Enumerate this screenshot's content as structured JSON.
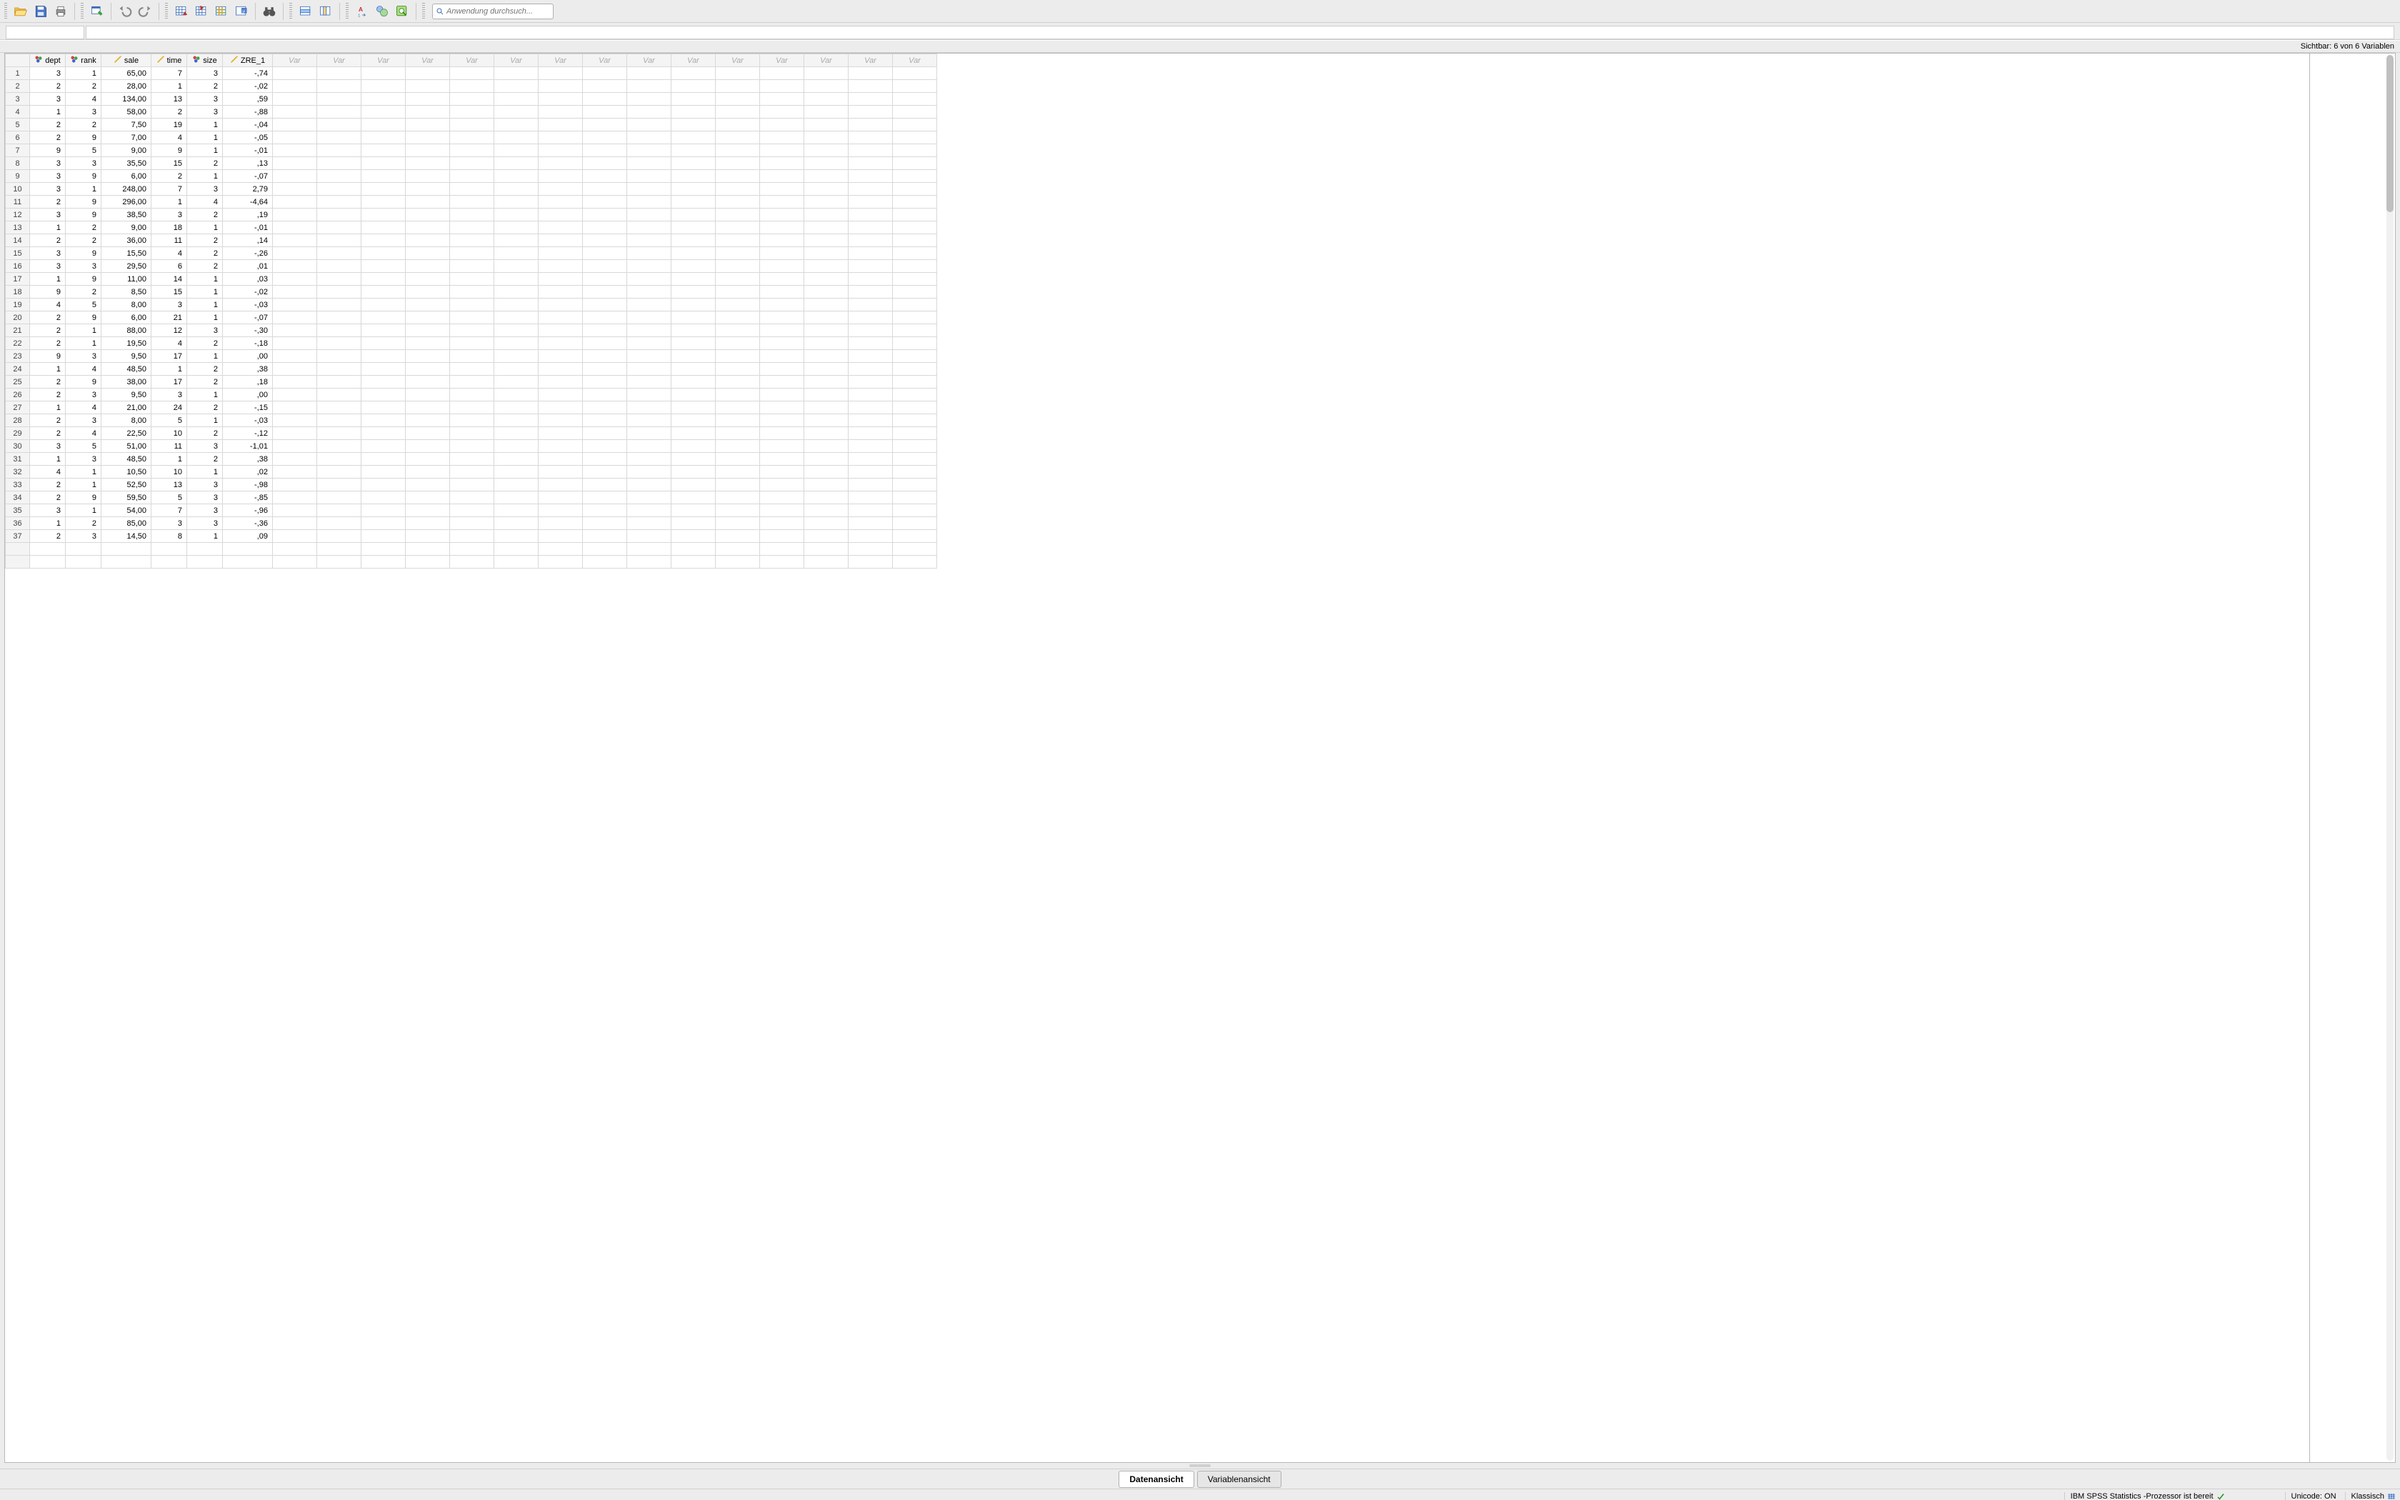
{
  "toolbar": {
    "search_placeholder": "Anwendung durchsuch..."
  },
  "visible_bar": "Sichtbar: 6 von 6 Variablen",
  "columns": [
    {
      "name": "dept",
      "type": "nominal",
      "width": "w-dept"
    },
    {
      "name": "rank",
      "type": "nominal",
      "width": "w-rank"
    },
    {
      "name": "sale",
      "type": "scale",
      "width": "w-sale"
    },
    {
      "name": "time",
      "type": "scale",
      "width": "w-time"
    },
    {
      "name": "size",
      "type": "nominal",
      "width": "w-size"
    },
    {
      "name": "ZRE_1",
      "type": "scale",
      "width": "w-zre"
    }
  ],
  "empty_var_label": "Var",
  "empty_var_count": 15,
  "rows": [
    {
      "dept": "3",
      "rank": "1",
      "sale": "65,00",
      "time": "7",
      "size": "3",
      "zre": "-,74"
    },
    {
      "dept": "2",
      "rank": "2",
      "sale": "28,00",
      "time": "1",
      "size": "2",
      "zre": "-,02"
    },
    {
      "dept": "3",
      "rank": "4",
      "sale": "134,00",
      "time": "13",
      "size": "3",
      "zre": ",59"
    },
    {
      "dept": "1",
      "rank": "3",
      "sale": "58,00",
      "time": "2",
      "size": "3",
      "zre": "-,88"
    },
    {
      "dept": "2",
      "rank": "2",
      "sale": "7,50",
      "time": "19",
      "size": "1",
      "zre": "-,04"
    },
    {
      "dept": "2",
      "rank": "9",
      "sale": "7,00",
      "time": "4",
      "size": "1",
      "zre": "-,05"
    },
    {
      "dept": "9",
      "rank": "5",
      "sale": "9,00",
      "time": "9",
      "size": "1",
      "zre": "-,01"
    },
    {
      "dept": "3",
      "rank": "3",
      "sale": "35,50",
      "time": "15",
      "size": "2",
      "zre": ",13"
    },
    {
      "dept": "3",
      "rank": "9",
      "sale": "6,00",
      "time": "2",
      "size": "1",
      "zre": "-,07"
    },
    {
      "dept": "3",
      "rank": "1",
      "sale": "248,00",
      "time": "7",
      "size": "3",
      "zre": "2,79"
    },
    {
      "dept": "2",
      "rank": "9",
      "sale": "296,00",
      "time": "1",
      "size": "4",
      "zre": "-4,64"
    },
    {
      "dept": "3",
      "rank": "9",
      "sale": "38,50",
      "time": "3",
      "size": "2",
      "zre": ",19"
    },
    {
      "dept": "1",
      "rank": "2",
      "sale": "9,00",
      "time": "18",
      "size": "1",
      "zre": "-,01"
    },
    {
      "dept": "2",
      "rank": "2",
      "sale": "36,00",
      "time": "11",
      "size": "2",
      "zre": ",14"
    },
    {
      "dept": "3",
      "rank": "9",
      "sale": "15,50",
      "time": "4",
      "size": "2",
      "zre": "-,26"
    },
    {
      "dept": "3",
      "rank": "3",
      "sale": "29,50",
      "time": "6",
      "size": "2",
      "zre": ",01"
    },
    {
      "dept": "1",
      "rank": "9",
      "sale": "11,00",
      "time": "14",
      "size": "1",
      "zre": ",03"
    },
    {
      "dept": "9",
      "rank": "2",
      "sale": "8,50",
      "time": "15",
      "size": "1",
      "zre": "-,02"
    },
    {
      "dept": "4",
      "rank": "5",
      "sale": "8,00",
      "time": "3",
      "size": "1",
      "zre": "-,03"
    },
    {
      "dept": "2",
      "rank": "9",
      "sale": "6,00",
      "time": "21",
      "size": "1",
      "zre": "-,07"
    },
    {
      "dept": "2",
      "rank": "1",
      "sale": "88,00",
      "time": "12",
      "size": "3",
      "zre": "-,30"
    },
    {
      "dept": "2",
      "rank": "1",
      "sale": "19,50",
      "time": "4",
      "size": "2",
      "zre": "-,18"
    },
    {
      "dept": "9",
      "rank": "3",
      "sale": "9,50",
      "time": "17",
      "size": "1",
      "zre": ",00"
    },
    {
      "dept": "1",
      "rank": "4",
      "sale": "48,50",
      "time": "1",
      "size": "2",
      "zre": ",38"
    },
    {
      "dept": "2",
      "rank": "9",
      "sale": "38,00",
      "time": "17",
      "size": "2",
      "zre": ",18"
    },
    {
      "dept": "2",
      "rank": "3",
      "sale": "9,50",
      "time": "3",
      "size": "1",
      "zre": ",00"
    },
    {
      "dept": "1",
      "rank": "4",
      "sale": "21,00",
      "time": "24",
      "size": "2",
      "zre": "-,15"
    },
    {
      "dept": "2",
      "rank": "3",
      "sale": "8,00",
      "time": "5",
      "size": "1",
      "zre": "-,03"
    },
    {
      "dept": "2",
      "rank": "4",
      "sale": "22,50",
      "time": "10",
      "size": "2",
      "zre": "-,12"
    },
    {
      "dept": "3",
      "rank": "5",
      "sale": "51,00",
      "time": "11",
      "size": "3",
      "zre": "-1,01"
    },
    {
      "dept": "1",
      "rank": "3",
      "sale": "48,50",
      "time": "1",
      "size": "2",
      "zre": ",38"
    },
    {
      "dept": "4",
      "rank": "1",
      "sale": "10,50",
      "time": "10",
      "size": "1",
      "zre": ",02"
    },
    {
      "dept": "2",
      "rank": "1",
      "sale": "52,50",
      "time": "13",
      "size": "3",
      "zre": "-,98"
    },
    {
      "dept": "2",
      "rank": "9",
      "sale": "59,50",
      "time": "5",
      "size": "3",
      "zre": "-,85"
    },
    {
      "dept": "3",
      "rank": "1",
      "sale": "54,00",
      "time": "7",
      "size": "3",
      "zre": "-,96"
    },
    {
      "dept": "1",
      "rank": "2",
      "sale": "85,00",
      "time": "3",
      "size": "3",
      "zre": "-,36"
    },
    {
      "dept": "2",
      "rank": "3",
      "sale": "14,50",
      "time": "8",
      "size": "1",
      "zre": ",09"
    }
  ],
  "tabs": {
    "data": "Datenansicht",
    "variable": "Variablenansicht"
  },
  "status": {
    "processor": "IBM SPSS Statistics -Prozessor ist bereit",
    "unicode": "Unicode: ON",
    "mode": "Klassisch"
  }
}
